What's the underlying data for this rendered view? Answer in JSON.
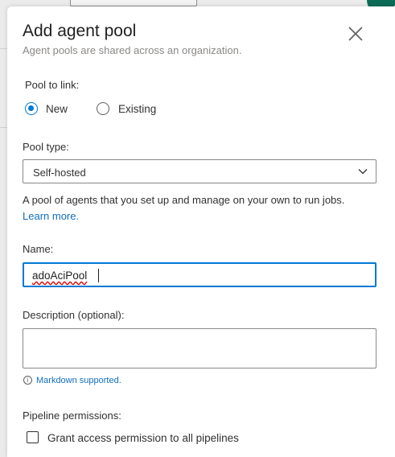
{
  "dialog": {
    "title": "Add agent pool",
    "subtitle": "Agent pools are shared across an organization."
  },
  "pool_to_link": {
    "label": "Pool to link:",
    "options": [
      {
        "label": "New",
        "selected": true
      },
      {
        "label": "Existing",
        "selected": false
      }
    ]
  },
  "pool_type": {
    "label": "Pool type:",
    "selected": "Self-hosted",
    "help_text": "A pool of agents that you set up and manage on your own to run jobs.",
    "learn_more": "Learn more."
  },
  "name": {
    "label": "Name:",
    "value": "adoAciPool"
  },
  "description": {
    "label": "Description (optional):",
    "value": "",
    "markdown_note": "Markdown supported."
  },
  "pipeline_permissions": {
    "label": "Pipeline permissions:",
    "grant_label": "Grant access permission to all pipelines",
    "grant_checked": false
  },
  "colors": {
    "accent": "#0078d4",
    "link": "#106ebe",
    "avatar": "#0c6b57"
  }
}
